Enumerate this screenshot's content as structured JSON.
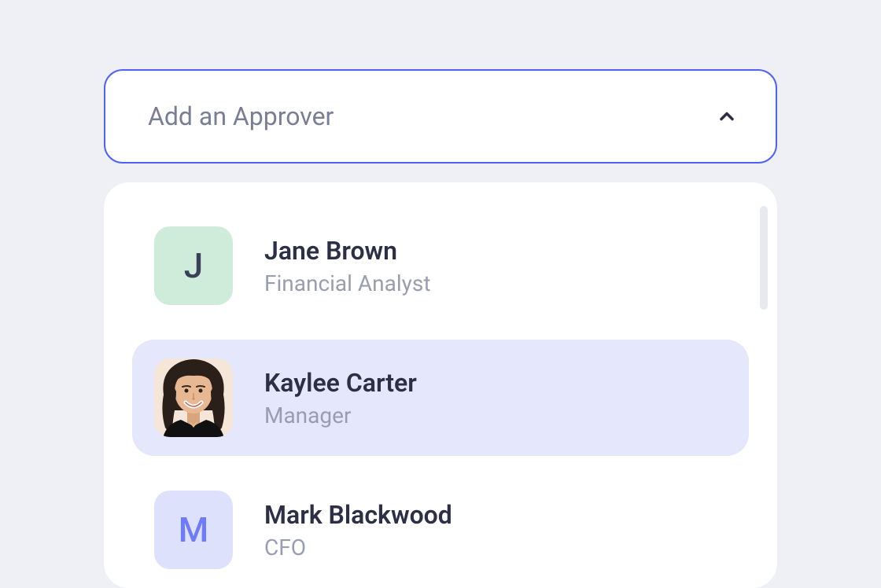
{
  "dropdown": {
    "placeholder": "Add an Approver",
    "expanded": true
  },
  "options": [
    {
      "name": "Jane Brown",
      "role": "Financial Analyst",
      "avatar_type": "initial",
      "initial": "J",
      "avatar_color": "green",
      "highlighted": false
    },
    {
      "name": "Kaylee Carter",
      "role": "Manager",
      "avatar_type": "photo",
      "initial": "",
      "avatar_color": "photo",
      "highlighted": true
    },
    {
      "name": "Mark Blackwood",
      "role": "CFO",
      "avatar_type": "initial",
      "initial": "M",
      "avatar_color": "blue",
      "highlighted": false
    }
  ]
}
